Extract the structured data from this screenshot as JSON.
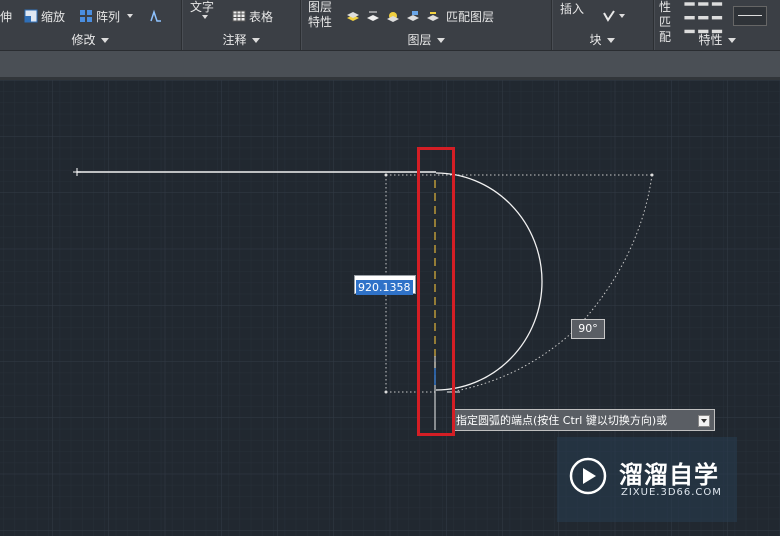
{
  "ribbon": {
    "modify": {
      "stretch_label": "伸",
      "scale_label": "缩放",
      "array_label": "阵列",
      "title": "修改"
    },
    "annotation": {
      "text_label": "文字",
      "table_label": "表格",
      "title": "注释"
    },
    "layers": {
      "properties_line1": "图层",
      "properties_line2": "特性",
      "match_layer_label": "匹配图层",
      "title": "图层"
    },
    "block": {
      "insert_label": "插入",
      "title": "块"
    },
    "properties": {
      "match_line1": "特性",
      "match_line2": "匹配",
      "title": "特性"
    }
  },
  "drawing": {
    "dynamic_input_value": "920.1358",
    "angle_value": "90°",
    "prompt_text": "指定圆弧的端点(按住 Ctrl 键以切换方向)或"
  },
  "watermark": {
    "brand": "溜溜自学",
    "url": "ZIXUE.3D66.COM"
  },
  "colors": {
    "canvas": "#212830",
    "ribbon": "#3b3f45",
    "highlight_box": "#d41e25",
    "input_selection": "#2f72c8",
    "centerline": "#e0b43a"
  },
  "icons": [
    "scale-icon",
    "array-icon",
    "stretch-icon",
    "table-icon",
    "layer-tool-icon",
    "insert-block-icon",
    "palette-icon"
  ]
}
